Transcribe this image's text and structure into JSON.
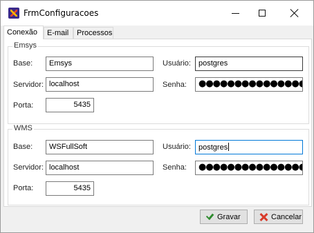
{
  "window": {
    "title": "FrmConfiguracoes"
  },
  "tabs": [
    {
      "label": "Conexão",
      "active": true
    },
    {
      "label": "E-mail",
      "active": false
    },
    {
      "label": "Processos",
      "active": false
    }
  ],
  "emsys": {
    "caption": "Emsys",
    "base_label": "Base:",
    "base_value": "Emsys",
    "servidor_label": "Servidor:",
    "servidor_value": "localhost",
    "porta_label": "Porta:",
    "porta_value": "5435",
    "usuario_label": "Usuário:",
    "usuario_value": "postgres",
    "senha_label": "Senha:",
    "senha_value": "●●●●●●●●●●●●●●●"
  },
  "wms": {
    "caption": "WMS",
    "base_label": "Base:",
    "base_value": "WSFullSoft",
    "servidor_label": "Servidor:",
    "servidor_value": "localhost",
    "porta_label": "Porta:",
    "porta_value": "5435",
    "usuario_label": "Usuário:",
    "usuario_value": "postgres",
    "senha_label": "Senha:",
    "senha_value": "●●●●●●●●●●●●●●●"
  },
  "buttons": {
    "gravar": "Gravar",
    "cancelar": "Cancelar"
  },
  "colors": {
    "focus_border": "#0078d7",
    "button_face": "#e1e1e1",
    "tab_strip": "#f0f0f0"
  },
  "icons": {
    "app": "app-icon",
    "gravar": "checkmark-icon",
    "cancelar": "x-icon"
  }
}
